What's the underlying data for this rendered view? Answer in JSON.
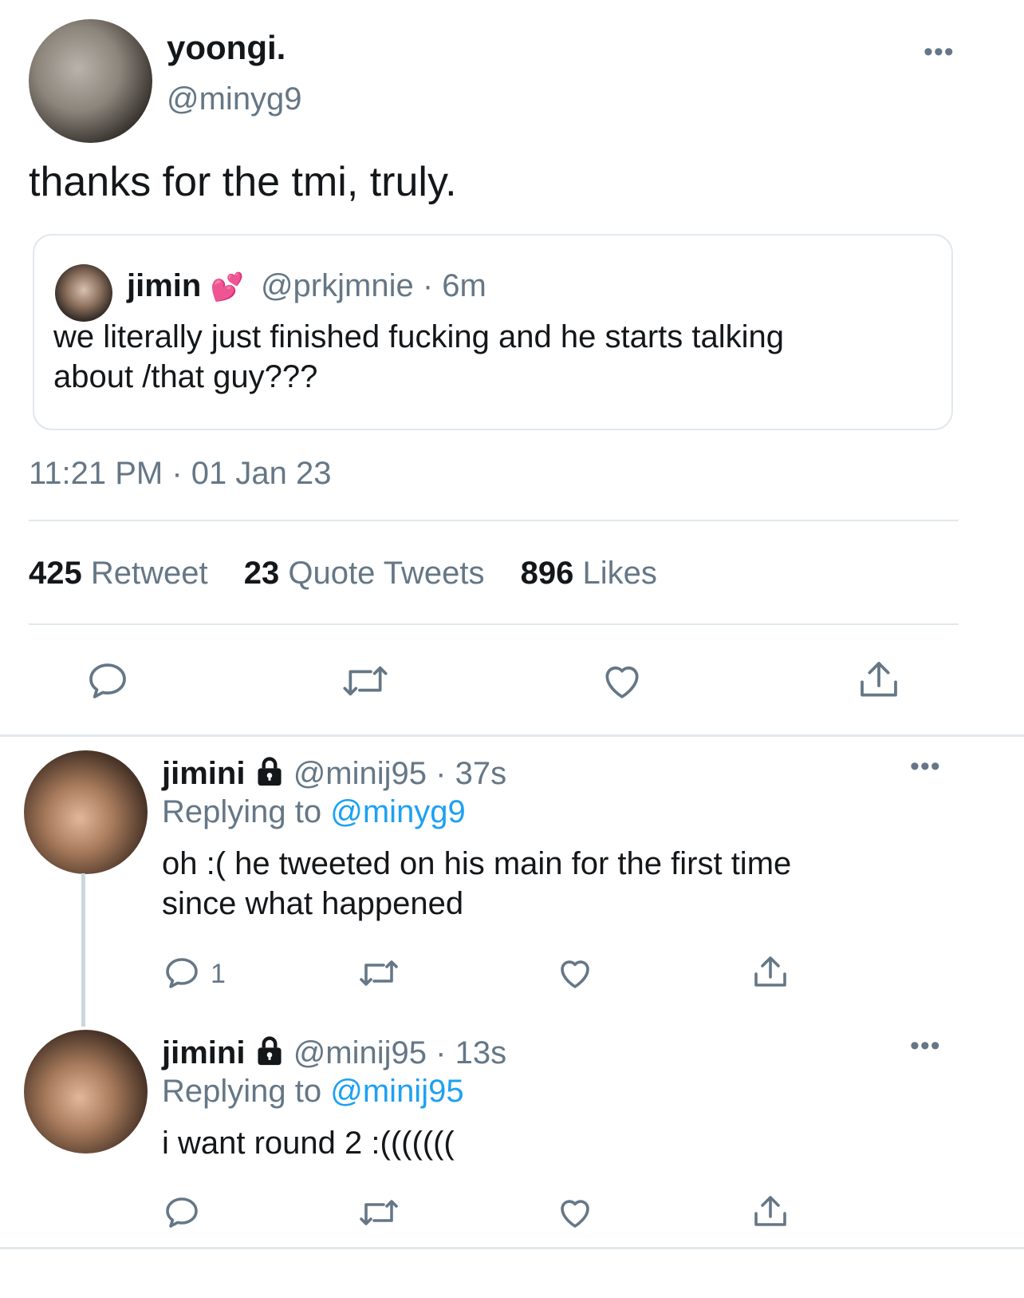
{
  "main": {
    "display_name": "yoongi.",
    "handle": "@minyg9",
    "text": "thanks for the tmi, truly.",
    "more_icon": "more-dots-icon",
    "quoted": {
      "display_name": "jimin",
      "emoji": "💕",
      "handle": "@prkjmnie",
      "time": "· 6m",
      "line1": "we literally just finished fucking and he starts talking",
      "line2": "about /that guy???"
    },
    "timestamp": "11:21 PM · 01 Jan 23",
    "stats": {
      "retweets_count": "425",
      "retweets_label": "Retweet",
      "quotes_count": "23",
      "quotes_label": "Quote Tweets",
      "likes_count": "896",
      "likes_label": "Likes"
    },
    "actions": [
      "reply-icon",
      "retweet-icon",
      "like-icon",
      "share-icon"
    ]
  },
  "replies": [
    {
      "display_name": "jimini",
      "lock_icon": "lock-icon",
      "handle": "@minij95",
      "time": "· 37s",
      "replying_prefix": "Replying to",
      "replying_handle": "@minyg9",
      "line1": "oh :( he tweeted on his main for the first time",
      "line2": "since what happened",
      "reply_count": "1"
    },
    {
      "display_name": "jimini",
      "lock_icon": "lock-icon",
      "handle": "@minij95",
      "time": "· 13s",
      "replying_prefix": "Replying to",
      "replying_handle": "@minij95",
      "line1": "i want round 2 :(((((((",
      "reply_count": ""
    }
  ],
  "colors": {
    "text": "#14171a",
    "muted": "#657786",
    "link": "#1da1f2",
    "divider": "#e1e8ed"
  }
}
